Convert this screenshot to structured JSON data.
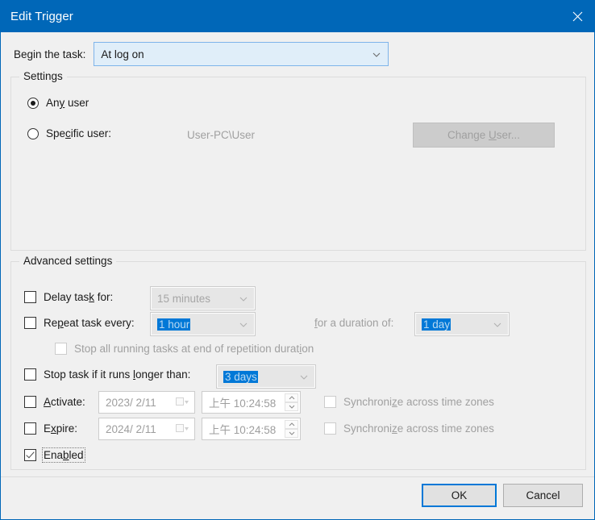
{
  "window": {
    "title": "Edit Trigger",
    "close_icon": "close-icon",
    "titlebar_color": "#0067b8"
  },
  "begin": {
    "label_pre": "Be",
    "label_accel": "g",
    "label_post": "in the task:",
    "value": "At log on"
  },
  "settings": {
    "title": "Settings",
    "any_user": {
      "pre": "An",
      "accel": "y",
      "post": " user",
      "checked": true
    },
    "specific_user": {
      "pre": "Spe",
      "accel": "c",
      "post": "ific user:",
      "checked": false
    },
    "user_value": "User-PC\\User",
    "change_user": {
      "pre": "Change ",
      "accel": "U",
      "post": "ser...",
      "disabled": true
    }
  },
  "advanced": {
    "title": "Advanced settings",
    "delay": {
      "pre": "Delay tas",
      "accel": "k",
      "post": " for:",
      "checked": false,
      "value": "15 minutes",
      "selected": false
    },
    "repeat": {
      "pre": "Re",
      "accel": "p",
      "post": "eat task every:",
      "checked": false,
      "value": "1 hour",
      "selected": true
    },
    "duration": {
      "pre": "",
      "accel": "f",
      "post": "or a duration of:",
      "value": "1 day",
      "selected": true
    },
    "stop_all": {
      "pre": "Stop all running tasks at end of repetition durat",
      "accel": "i",
      "post": "on",
      "checked": false,
      "disabled": true
    },
    "stop_longer": {
      "pre": "Stop task if it runs ",
      "accel": "l",
      "post": "onger than:",
      "checked": false,
      "value": "3 days",
      "selected": true
    },
    "activate": {
      "pre": "",
      "accel": "A",
      "post": "ctivate:",
      "checked": false,
      "date": "2023/ 2/11",
      "time": "上午 10:24:58",
      "sync": {
        "pre": "Synchroni",
        "accel": "z",
        "post": "e across time zones",
        "checked": false,
        "disabled": true
      }
    },
    "expire": {
      "pre": "E",
      "accel": "x",
      "post": "pire:",
      "checked": false,
      "date": "2024/ 2/11",
      "time": "上午 10:24:58",
      "sync": {
        "pre": "Synchroni",
        "accel": "z",
        "post": "e across time zones",
        "checked": false,
        "disabled": true
      }
    },
    "enabled": {
      "pre": "Ena",
      "accel": "b",
      "post": "led",
      "checked": true
    }
  },
  "footer": {
    "ok": "OK",
    "cancel": "Cancel",
    "default_button": "OK",
    "accent_color": "#0078d7"
  }
}
